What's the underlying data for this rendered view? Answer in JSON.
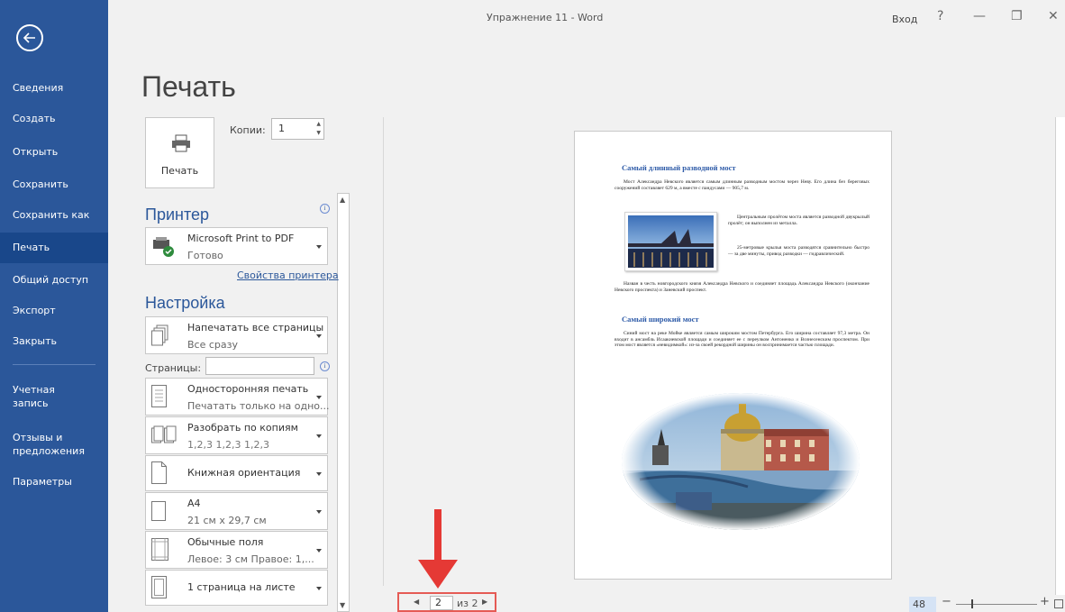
{
  "window": {
    "title": "Упражнение 11 - Word",
    "sign_in": "Вход",
    "help": "?",
    "minimize": "—",
    "restore": "❐",
    "close": "✕"
  },
  "nav": {
    "items": [
      {
        "label": "Сведения"
      },
      {
        "label": "Создать"
      },
      {
        "label": "Открыть"
      },
      {
        "label": "Сохранить"
      },
      {
        "label": "Сохранить как"
      },
      {
        "label": "Печать",
        "active": true
      },
      {
        "label": "Общий доступ"
      },
      {
        "label": "Экспорт"
      },
      {
        "label": "Закрыть"
      },
      {
        "label": "Учетная\nзапись"
      },
      {
        "label": "Отзывы и\nпредложения"
      },
      {
        "label": "Параметры"
      }
    ]
  },
  "page_title": "Печать",
  "print_button": {
    "label": "Печать"
  },
  "copies": {
    "label": "Копии:",
    "value": "1"
  },
  "printer": {
    "heading": "Принтер",
    "name": "Microsoft Print to PDF",
    "status": "Готово",
    "properties_link": "Свойства принтера"
  },
  "settings": {
    "heading": "Настройка",
    "print_what": {
      "title": "Напечатать все страницы",
      "sub": "Все сразу"
    },
    "pages_label": "Страницы:",
    "pages_value": "",
    "sides": {
      "title": "Односторонняя печать",
      "sub": "Печатать только на одно..."
    },
    "collate": {
      "title": "Разобрать по копиям",
      "sub": "1,2,3   1,2,3   1,2,3"
    },
    "orientation": {
      "title": "Книжная ориентация"
    },
    "paper": {
      "title": "A4",
      "sub": "21 см x 29,7 см"
    },
    "margins": {
      "title": "Обычные поля",
      "sub": "Левое:  3 см   Правое:  1,..."
    },
    "per_sheet": {
      "title": "1 страница на листе"
    }
  },
  "preview": {
    "heading1": "Самый длинный разводной мост",
    "p1": "Мост Александра Невского является самым длинным разводным мостом через Неву. Его длина без береговых сооружений составляет 629 м, а вместе с пандусами — 905,7 м.",
    "p2": "Центральным пролётом моста является разводной двукрылый пролёт; он выполнен из металла.",
    "p3": "25-метровые крылья моста разводятся сравнительно быстро — за две минуты, привод разводки — гидравлический.",
    "p4": "Назван в честь новгородского князя Александра Невского и соединяет площадь Александра Невского (окончание Невского проспекта) и Заневский проспект.",
    "heading2": "Самый широкий мост",
    "p5": "Синий мост на реке Мойке является самым широким мостом Петербурга. Его ширина составляет 97,3 метра. Он входит в ансамбль Исаакиевской площади и соединяет ее с переулком Антоненко и Вознесенским проспектом. При этом мост является «невидимкой»: из-за своей рекордной ширины он воспринимается частью площади."
  },
  "page_nav": {
    "current": "2",
    "of_text": "из 2"
  },
  "zoom": {
    "value": "48 %",
    "level": 48
  },
  "colors": {
    "nav_bg": "#2b579a",
    "accent": "#2b579a",
    "annotation": "#e53935"
  }
}
